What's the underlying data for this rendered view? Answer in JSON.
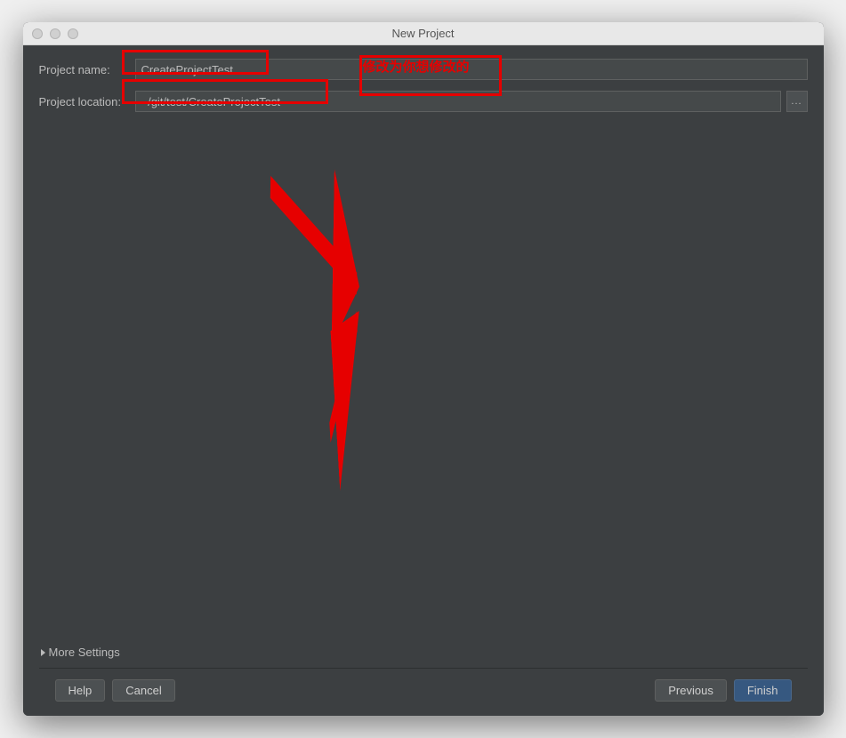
{
  "window": {
    "title": "New Project"
  },
  "form": {
    "projectNameLabel": "Project name:",
    "projectNameValue": "CreateProjectTest",
    "projectLocationLabel": "Project location:",
    "projectLocationValue": "~/git/test/CreateProjectTest",
    "browseLabel": "..."
  },
  "moreSettings": {
    "label": "More Settings"
  },
  "buttons": {
    "help": "Help",
    "cancel": "Cancel",
    "previous": "Previous",
    "finish": "Finish"
  },
  "annotation": {
    "text": "修改为你想修改的"
  },
  "colors": {
    "annotation": "#e60000",
    "background": "#3c3f41",
    "inputBg": "#45494a",
    "primaryBtn": "#365880"
  }
}
